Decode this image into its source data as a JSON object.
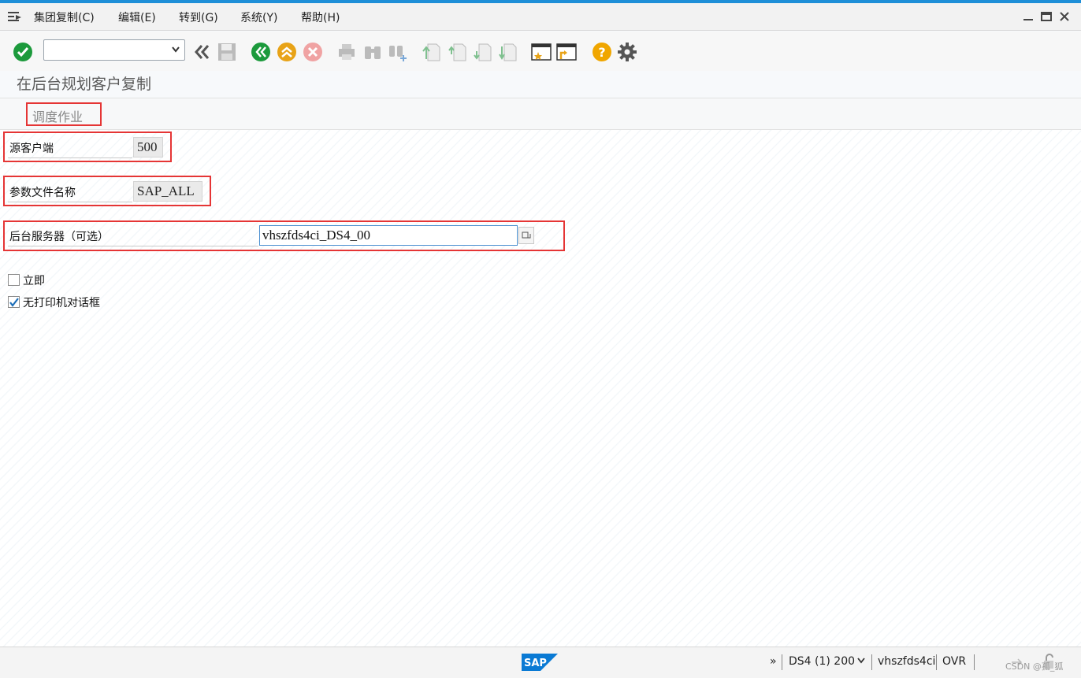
{
  "menu": {
    "items": [
      "集团复制(C)",
      "编辑(E)",
      "转到(G)",
      "系统(Y)",
      "帮助(H)"
    ]
  },
  "toolbar": {
    "command_value": "",
    "icons": [
      "enter-icon",
      "back-icon",
      "save-icon",
      "back-green-icon",
      "exit-icon",
      "cancel-icon",
      "print-icon",
      "find-icon",
      "find-next-icon",
      "first-page-icon",
      "prev-page-icon",
      "next-page-icon",
      "last-page-icon",
      "new-session-icon",
      "shortcut-icon",
      "help-icon",
      "settings-icon"
    ]
  },
  "page": {
    "title": "在后台规划客户复制",
    "schedule_button": "调度作业"
  },
  "form": {
    "source_client_label": "源客户端",
    "source_client_value": "500",
    "profile_label": "参数文件名称",
    "profile_value": "SAP_ALL",
    "server_label": "后台服务器（可选）",
    "server_value": "vhszfds4ci_DS4_00",
    "immediate_label": "立即",
    "immediate_checked": false,
    "no_print_dialog_label": "无打印机对话框",
    "no_print_dialog_checked": true
  },
  "status": {
    "expand": "»",
    "system": "DS4 (1) 200",
    "server": "vhszfds4ci",
    "mode": "OVR",
    "watermark": "CSDN @孤_狐"
  },
  "colors": {
    "accent": "#1e8fd8",
    "highlight": "#e53535"
  }
}
